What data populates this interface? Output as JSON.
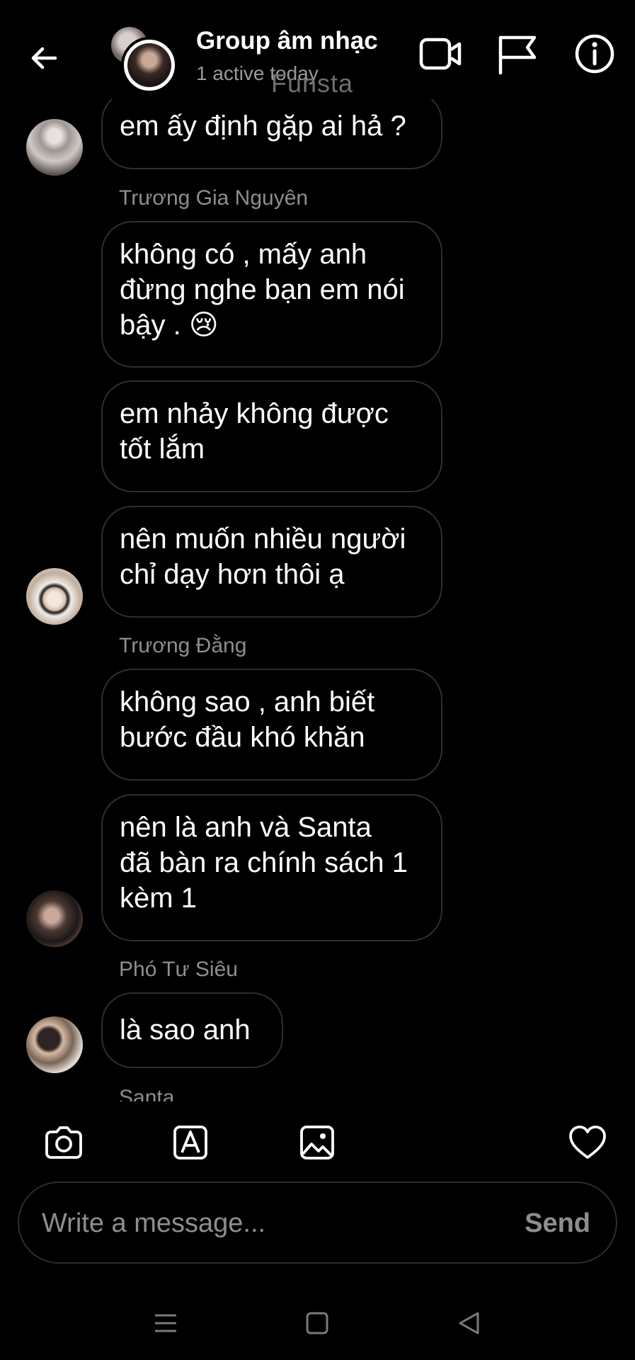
{
  "header": {
    "title": "Group âm nhạc",
    "subtitle": "1 active today",
    "watermark": "Funsta"
  },
  "messages": [
    {
      "type": "bubble",
      "lines": [
        "em ấy định gặp ai hả ?"
      ]
    },
    {
      "type": "sender",
      "text": "Trương Gia Nguyên"
    },
    {
      "type": "bubble",
      "lines": [
        "không có , mấy anh",
        "đừng nghe bạn em nói",
        "bậy . 😢"
      ]
    },
    {
      "type": "bubble",
      "lines": [
        "em nhảy không được",
        "tốt lắm"
      ]
    },
    {
      "type": "bubble",
      "lines": [
        "nên muốn nhiều người",
        "chỉ dạy hơn thôi ạ"
      ]
    },
    {
      "type": "sender",
      "text": "Trương Đằng"
    },
    {
      "type": "bubble",
      "lines": [
        "không sao , anh biết",
        "bước đầu khó khăn"
      ]
    },
    {
      "type": "bubble",
      "lines": [
        "nên là anh và Santa",
        "đã bàn ra chính sách 1",
        "kèm 1"
      ]
    },
    {
      "type": "sender",
      "text": "Phó Tư Siêu"
    },
    {
      "type": "bubble",
      "lines": [
        "là sao anh"
      ]
    },
    {
      "type": "sender",
      "text": "Santa"
    }
  ],
  "composer": {
    "placeholder": "Write a message...",
    "send_label": "Send"
  },
  "icons": {
    "back": "arrow-left-icon",
    "video": "video-camera-icon",
    "report": "flag-icon",
    "info": "info-icon",
    "camera": "camera-icon",
    "sticker": "sticker-icon",
    "gallery": "image-icon",
    "like": "heart-icon"
  },
  "colors": {
    "background": "#000000",
    "bubble_border": "#2f2f2f",
    "muted_text": "#8e8e8e"
  }
}
